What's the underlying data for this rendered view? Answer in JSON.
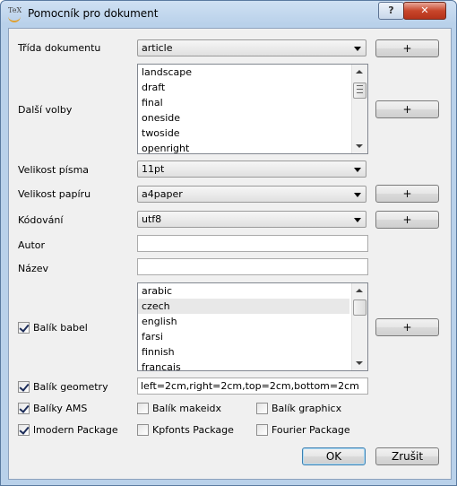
{
  "window": {
    "title": "Pomocník pro dokument",
    "icon_label": "TeX",
    "help_label": "?",
    "close_label": "✕"
  },
  "form": {
    "document_class": {
      "label": "Třída dokumentu",
      "value": "article",
      "add_label": "+"
    },
    "other_options": {
      "label": "Další volby",
      "items": [
        "landscape",
        "draft",
        "final",
        "oneside",
        "twoside",
        "openright"
      ],
      "add_label": "+"
    },
    "font_size": {
      "label": "Velikost písma",
      "value": "11pt"
    },
    "paper_size": {
      "label": "Velikost papíru",
      "value": "a4paper",
      "add_label": "+"
    },
    "encoding": {
      "label": "Kódování",
      "value": "utf8",
      "add_label": "+"
    },
    "author": {
      "label": "Autor",
      "value": ""
    },
    "title": {
      "label": "Název",
      "value": ""
    },
    "babel": {
      "label": "Balík babel",
      "checked": true,
      "items": [
        "arabic",
        "czech",
        "english",
        "farsi",
        "finnish",
        "francais"
      ],
      "selected": "czech",
      "add_label": "+"
    },
    "geometry": {
      "label": "Balík geometry",
      "checked": true,
      "value": "left=2cm,right=2cm,top=2cm,bottom=2cm"
    },
    "packages": [
      {
        "label": "Balíky AMS",
        "checked": true
      },
      {
        "label": "Balík makeidx",
        "checked": false
      },
      {
        "label": "Balík graphicx",
        "checked": false
      },
      {
        "label": "lmodern Package",
        "checked": true
      },
      {
        "label": "Kpfonts Package",
        "checked": false
      },
      {
        "label": "Fourier Package",
        "checked": false
      }
    ]
  },
  "buttons": {
    "ok": "OK",
    "cancel": "Zrušit"
  }
}
